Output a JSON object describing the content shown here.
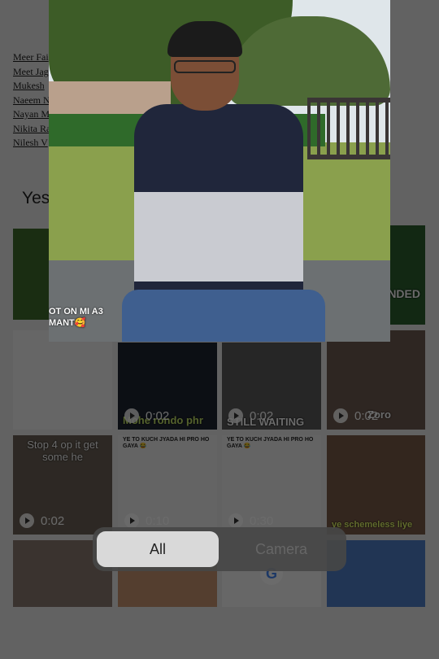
{
  "document_links": [
    "Meer Fai",
    "Meet Jag",
    "Mukesh",
    "Naeem N",
    "Nayan M",
    "Nikita Ra",
    "Nilesh V"
  ],
  "section_title": "Yes",
  "overlay": {
    "caption_line1": "OT ON MI A3",
    "caption_line2": "MANT🥰"
  },
  "tiles": [
    {
      "name": "tile-tom-jerry",
      "duration": "",
      "caption": ""
    },
    {
      "name": "tile-have-i-ended",
      "duration": "",
      "caption": "HAVE I ENDED"
    },
    {
      "name": "tile-list-screenshot",
      "duration": "",
      "caption": ""
    },
    {
      "name": "tile-mohe-rondo",
      "duration": "0:02",
      "caption": "Mohe rondo phr"
    },
    {
      "name": "tile-still-waiting",
      "duration": "0:02",
      "caption": "STILL WAITING"
    },
    {
      "name": "tile-zoro",
      "duration": "0:02",
      "caption": "Zoro"
    },
    {
      "name": "tile-stop",
      "duration": "0:02",
      "caption": "Stop 4 op it get some he"
    },
    {
      "name": "tile-graph-1",
      "duration": "0:10",
      "caption": "YE TO KUCH JYADA HI PRO HO GAYA 😂"
    },
    {
      "name": "tile-graph-2",
      "duration": "0:30",
      "caption": "YE TO KUCH JYADA HI PRO HO GAYA 😂"
    },
    {
      "name": "tile-schemeless",
      "duration": "",
      "caption": "ye schemeless liye"
    },
    {
      "name": "tile-family",
      "duration": "",
      "caption": ""
    },
    {
      "name": "tile-crowd",
      "duration": "",
      "caption": ""
    },
    {
      "name": "tile-google",
      "duration": "",
      "caption": ""
    },
    {
      "name": "tile-simpsons",
      "duration": "",
      "caption": ""
    }
  ],
  "segments": {
    "all": "All",
    "camera": "Camera"
  },
  "google_letter": "G"
}
